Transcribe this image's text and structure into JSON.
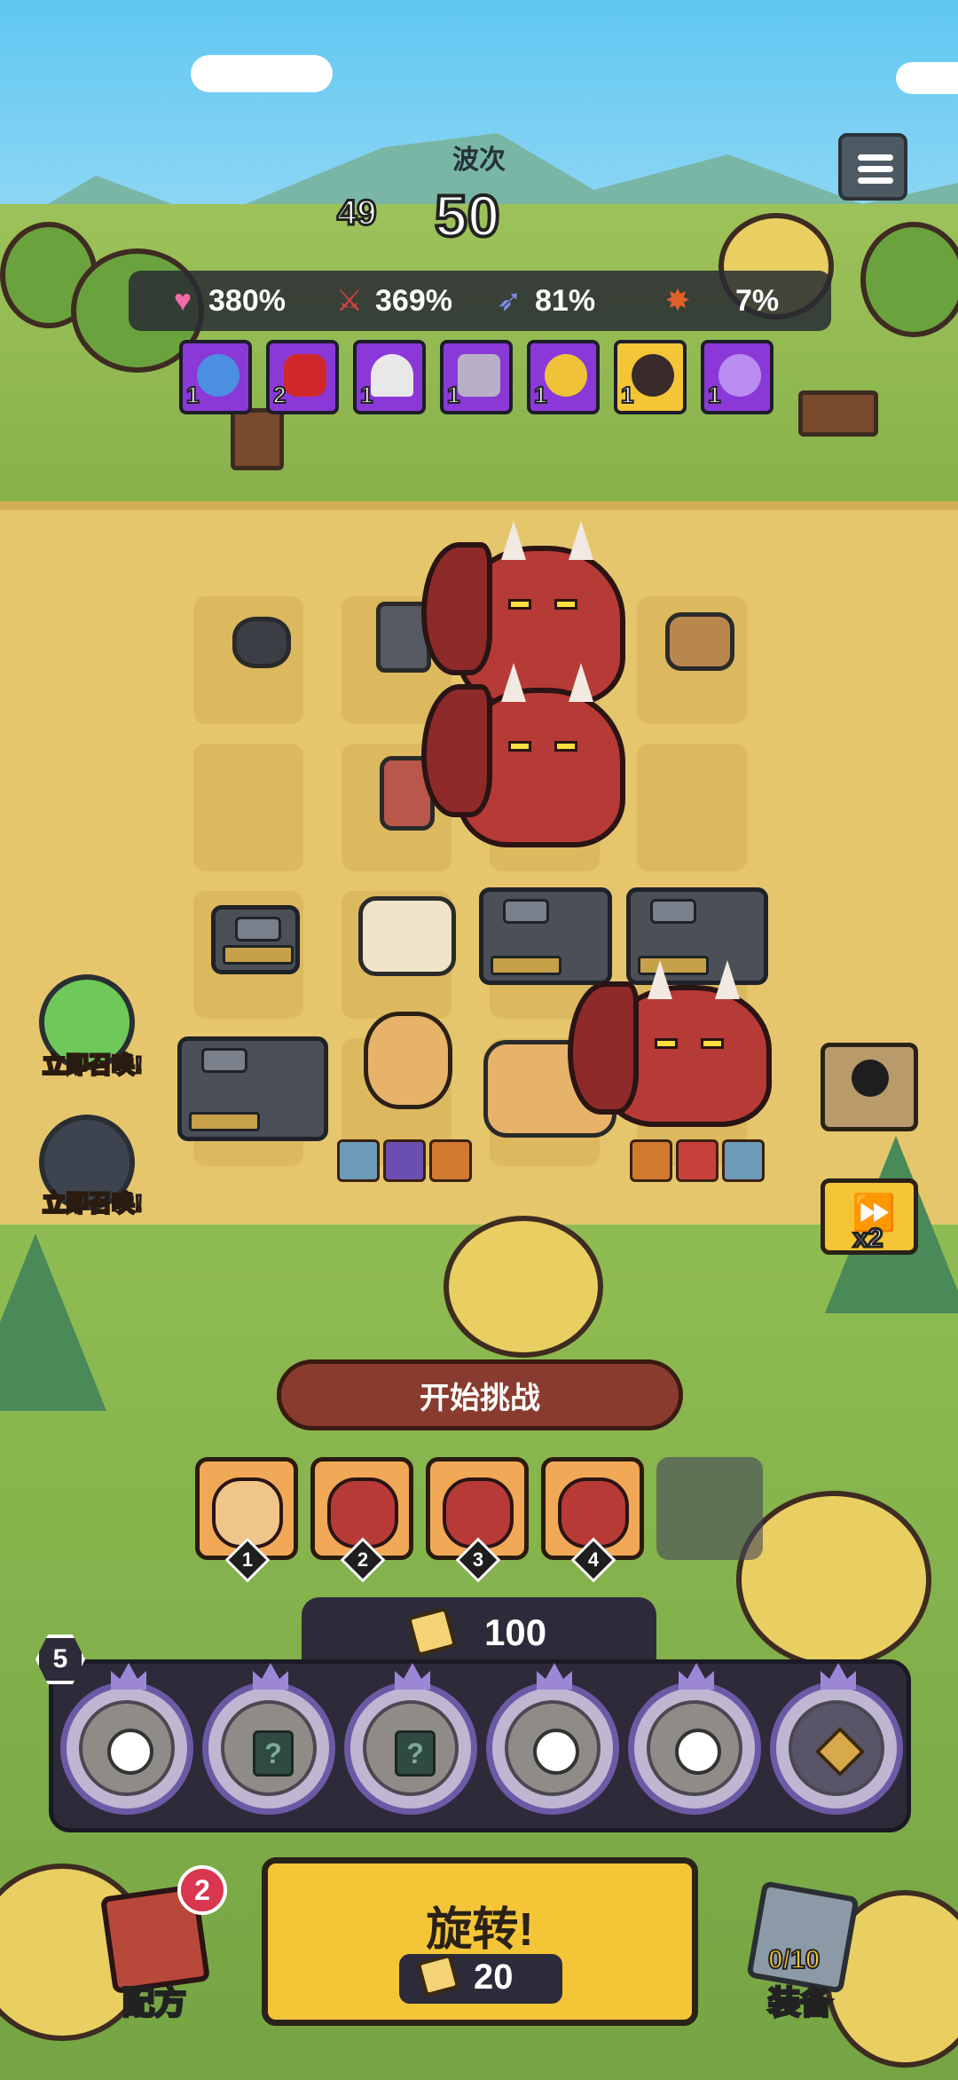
{
  "wave": {
    "label": "波次",
    "previous": "49",
    "current": "50"
  },
  "stats": [
    {
      "icon": "heart-icon",
      "value": "380%",
      "color": "#f26aa5"
    },
    {
      "icon": "sword-icon",
      "value": "369%",
      "color": "#e04040"
    },
    {
      "icon": "wing-boots-icon",
      "value": "81%",
      "color": "#7f8df0"
    },
    {
      "icon": "critical-burst-icon",
      "value": "7%",
      "color": "#e0602a"
    }
  ],
  "buffs": [
    {
      "icon": "stopwatch-cycle-icon",
      "level": "1",
      "color": "#8a39d8"
    },
    {
      "icon": "blood-splash-icon",
      "level": "2",
      "color": "#8a39d8"
    },
    {
      "icon": "parachute-supply-icon",
      "level": "1",
      "color": "#8a39d8"
    },
    {
      "icon": "summon-statues-icon",
      "level": "1",
      "color": "#8a39d8"
    },
    {
      "icon": "heart-lightning-icon",
      "level": "1",
      "color": "#8a39d8"
    },
    {
      "icon": "target-crosshair-icon",
      "level": "1",
      "color": "#f4c537"
    },
    {
      "icon": "lightning-scroll-icon",
      "level": "1",
      "color": "#8a39d8"
    }
  ],
  "summons": [
    {
      "icon": "frog-hero-icon",
      "label": "立即召唤!"
    },
    {
      "icon": "dark-knight-hero-icon",
      "label": "立即召唤!"
    }
  ],
  "speed": {
    "multiplier": "x2"
  },
  "challenge_button": "开始挑战",
  "queue": [
    {
      "icon": "cat-hero-portrait-icon",
      "number": "1"
    },
    {
      "icon": "red-dragon-portrait-icon",
      "number": "2"
    },
    {
      "icon": "red-dragon-portrait-icon",
      "number": "3"
    },
    {
      "icon": "red-dragon-portrait-icon",
      "number": "4"
    }
  ],
  "gold": {
    "amount": "100"
  },
  "level_badge": "5",
  "slots": [
    {
      "icon": "person-slot-icon"
    },
    {
      "icon": "mystery-card-icon",
      "glyph": "?"
    },
    {
      "icon": "mystery-card-icon",
      "glyph": "?"
    },
    {
      "icon": "person-slot-icon"
    },
    {
      "icon": "person-slot-icon"
    },
    {
      "icon": "diamond-slot-icon"
    }
  ],
  "spin": {
    "label": "旋转!",
    "cost": "20"
  },
  "recipe": {
    "label": "配方",
    "badge": "2"
  },
  "equipment": {
    "label": "装备",
    "count": "0/10"
  }
}
